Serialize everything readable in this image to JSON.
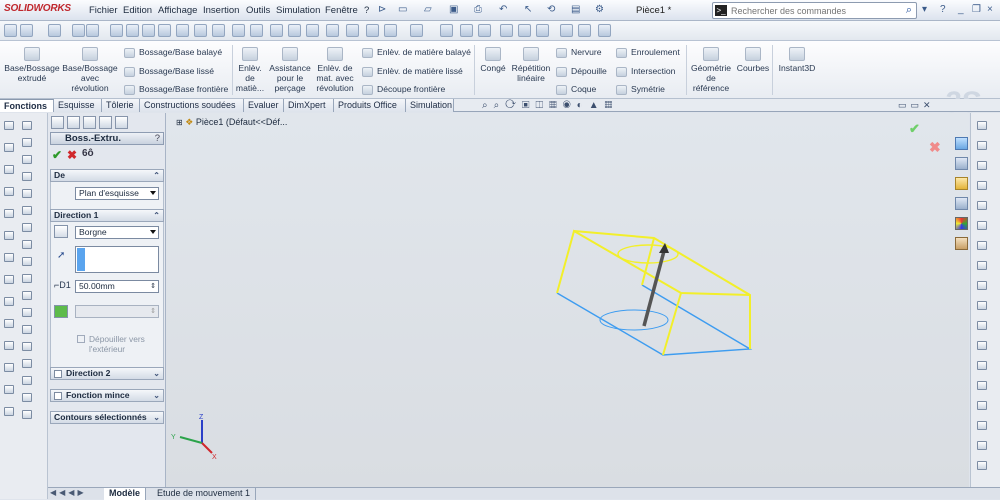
{
  "app": {
    "brand": "SOLIDWORKS",
    "document_title": "Pièce1 *"
  },
  "menu": [
    "Fichier",
    "Edition",
    "Affichage",
    "Insertion",
    "Outils",
    "Simulation",
    "Fenêtre",
    "?"
  ],
  "search": {
    "placeholder": "Rechercher des commandes"
  },
  "ribbon": {
    "base_bossage": "Base/Bossage extrudé",
    "base_revolution": "Base/Bossage avec révolution",
    "bossage_balaye": "Bossage/Base balayé",
    "bossage_lisse": "Bossage/Base lissé",
    "bossage_frontiere": "Bossage/Base frontière",
    "enlev_matiere": "Enlèv. de matiè...",
    "assistance_percage": "Assistance pour le perçage",
    "enlev_revolution": "Enlèv. de mat. avec révolution",
    "enlev_balaye": "Enlèv. de matière balayé",
    "enlev_lisse": "Enlèv. de matière lissé",
    "decoupe_frontiere": "Découpe frontière",
    "conge": "Congé",
    "repetition": "Répétition linéaire",
    "nervure": "Nervure",
    "depouille": "Dépouille",
    "coque": "Coque",
    "enroulement": "Enroulement",
    "intersection": "Intersection",
    "symetrie": "Symétrie",
    "geometrie": "Géométrie de référence",
    "courbes": "Courbes",
    "instant3d": "Instant3D"
  },
  "tabs": [
    "Fonctions",
    "Esquisse",
    "Tôlerie",
    "Constructions soudées",
    "Evaluer",
    "DimXpert",
    "Produits Office",
    "Simulation"
  ],
  "property_manager": {
    "title": "Boss.-Extru.",
    "help": "?",
    "de": {
      "label": "De",
      "value": "Plan d'esquisse"
    },
    "direction1": {
      "label": "Direction 1",
      "end_condition": "Borgne",
      "depth": "50.00mm",
      "draft_label": "Dépouiller vers l'extérieur"
    },
    "direction2": {
      "label": "Direction 2"
    },
    "fonction_mince": {
      "label": "Fonction mince"
    },
    "contours": {
      "label": "Contours sélectionnés"
    }
  },
  "feature_tree": {
    "root": "Pièce1  (Défaut<<Déf..."
  },
  "bottom_tabs": [
    "Modèle",
    "Etude de mouvement 1"
  ],
  "colors": {
    "preview_yellow": "#f2ef2a",
    "preview_blue": "#3d9cf0",
    "ok_green": "#2e9a2a",
    "cancel_red": "#d0282c"
  }
}
